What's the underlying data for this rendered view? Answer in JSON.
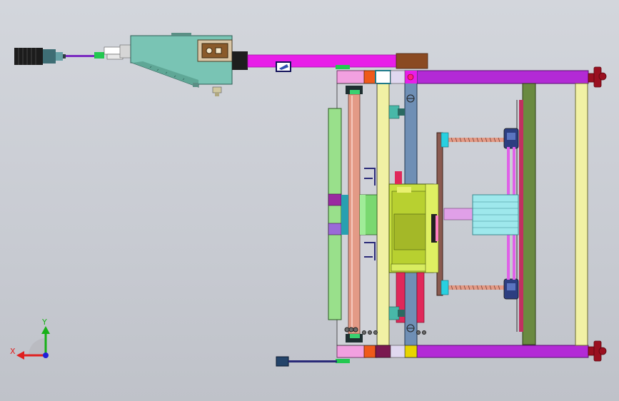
{
  "viewport": {
    "background_top": "#d3d6dc",
    "background_bottom": "#bfc2c9"
  },
  "triad": {
    "x_label": "X",
    "y_label": "Y",
    "x_color": "#e02020",
    "y_color": "#18b018",
    "z_color": "#2020d8"
  },
  "colors": {
    "magenta": "#e81ee8",
    "purple_bar": "#b32ad6",
    "teal_body": "#79c4b4",
    "light_yellow": "#f1f1a4",
    "steel_blue": "#6f8fb5",
    "green_plate": "#99e08b",
    "olive_green": "#6a8a40",
    "salmon_rod": "#e39a86",
    "red_rod": "#e0285a",
    "pink": "#f28bd6",
    "gold": "#e8d400",
    "dark_red": "#9a1020",
    "brown": "#8a4a22",
    "orange": "#ef5a1a",
    "lime": "#c8e040",
    "dark_blue": "#2c3e80",
    "cyan": "#28d0e0"
  },
  "icons": [
    "cylinder-motor-icon",
    "triad-axis-icon"
  ]
}
